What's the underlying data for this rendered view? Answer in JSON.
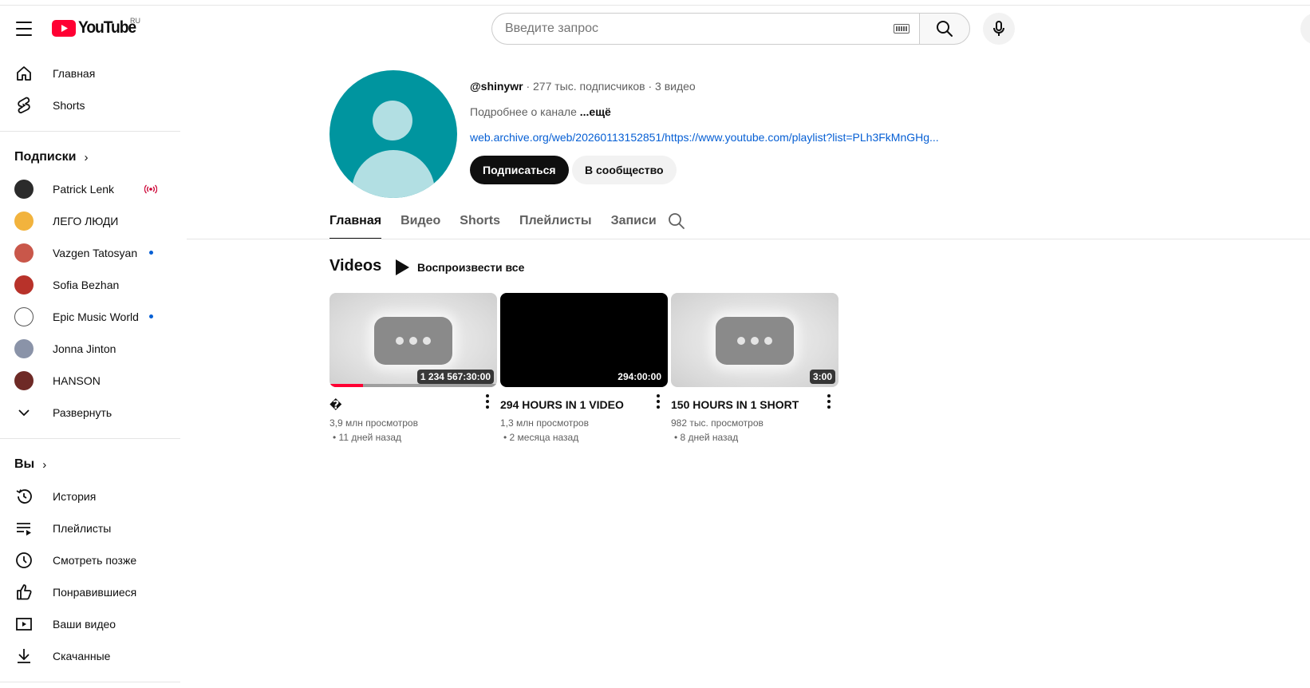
{
  "masthead": {
    "logo_text": "YouTube",
    "country_code": "RU",
    "search_placeholder": "Введите запрос"
  },
  "sidebar": {
    "main": [
      {
        "label": "Главная",
        "icon": "home-icon"
      },
      {
        "label": "Shorts",
        "icon": "shorts-icon"
      }
    ],
    "subscriptions_title": "Подписки",
    "subscriptions": [
      {
        "label": "Patrick Lenk",
        "avatar_color": "#2b2b2b",
        "status": "live"
      },
      {
        "label": "ЛЕГО ЛЮДИ",
        "avatar_color": "#f2b33d",
        "status": ""
      },
      {
        "label": "Vazgen Tatosyan",
        "avatar_color": "#c9574a",
        "status": "new"
      },
      {
        "label": "Sofia Bezhan",
        "avatar_color": "#b8322a",
        "status": ""
      },
      {
        "label": "Epic Music World",
        "avatar_color": "#ffffff",
        "status": "new"
      },
      {
        "label": "Jonna Jinton",
        "avatar_color": "#8a93a8",
        "status": ""
      },
      {
        "label": "HANSON",
        "avatar_color": "#6e2a26",
        "status": ""
      }
    ],
    "expand_label": "Развернуть",
    "you_title": "Вы",
    "you": [
      {
        "label": "История",
        "icon": "history-icon"
      },
      {
        "label": "Плейлисты",
        "icon": "playlists-icon"
      },
      {
        "label": "Смотреть позже",
        "icon": "watch-later-icon"
      },
      {
        "label": "Понравившиеся",
        "icon": "thumb-up-icon"
      },
      {
        "label": "Ваши видео",
        "icon": "your-videos-icon"
      },
      {
        "label": "Скачанные",
        "icon": "download-icon"
      }
    ]
  },
  "channel": {
    "handle": "@shinywr",
    "meta": " · 277 тыс. подписчиков · 3 видео",
    "description": "Подробнее о канале ",
    "more": "...ещё",
    "link": "web.archive.org/web/20260113152851/https://www.youtube.com/playlist?list=PLh3FkMnGHg...",
    "subscribe_label": "Подписаться",
    "community_label": "В сообщество"
  },
  "tabs": [
    {
      "label": "Главная",
      "active": true
    },
    {
      "label": "Видео",
      "active": false
    },
    {
      "label": "Shorts",
      "active": false
    },
    {
      "label": "Плейлисты",
      "active": false
    },
    {
      "label": "Записи",
      "active": false
    }
  ],
  "shelf": {
    "title": "Videos",
    "play_all": "Воспроизвести все"
  },
  "videos": [
    {
      "title": "�",
      "duration": "1 234 567:30:00",
      "views": "3,9 млн просмотров",
      "age": "• 11 дней назад",
      "thumb": "placeholder",
      "watched_progress": 0.2
    },
    {
      "title": "294 HOURS IN 1 VIDEO",
      "duration": "294:00:00",
      "views": "1,3 млн просмотров",
      "age": "• 2 месяца назад",
      "thumb": "black",
      "watched_progress": 0
    },
    {
      "title": "150 HOURS IN 1 SHORT",
      "duration": "3:00",
      "views": "982 тыс. просмотров",
      "age": "• 8 дней назад",
      "thumb": "placeholder",
      "watched_progress": 0
    }
  ],
  "colors": {
    "brand_red": "#ff0033",
    "link_blue": "#065fd4",
    "channel_avatar": "#00959f"
  }
}
